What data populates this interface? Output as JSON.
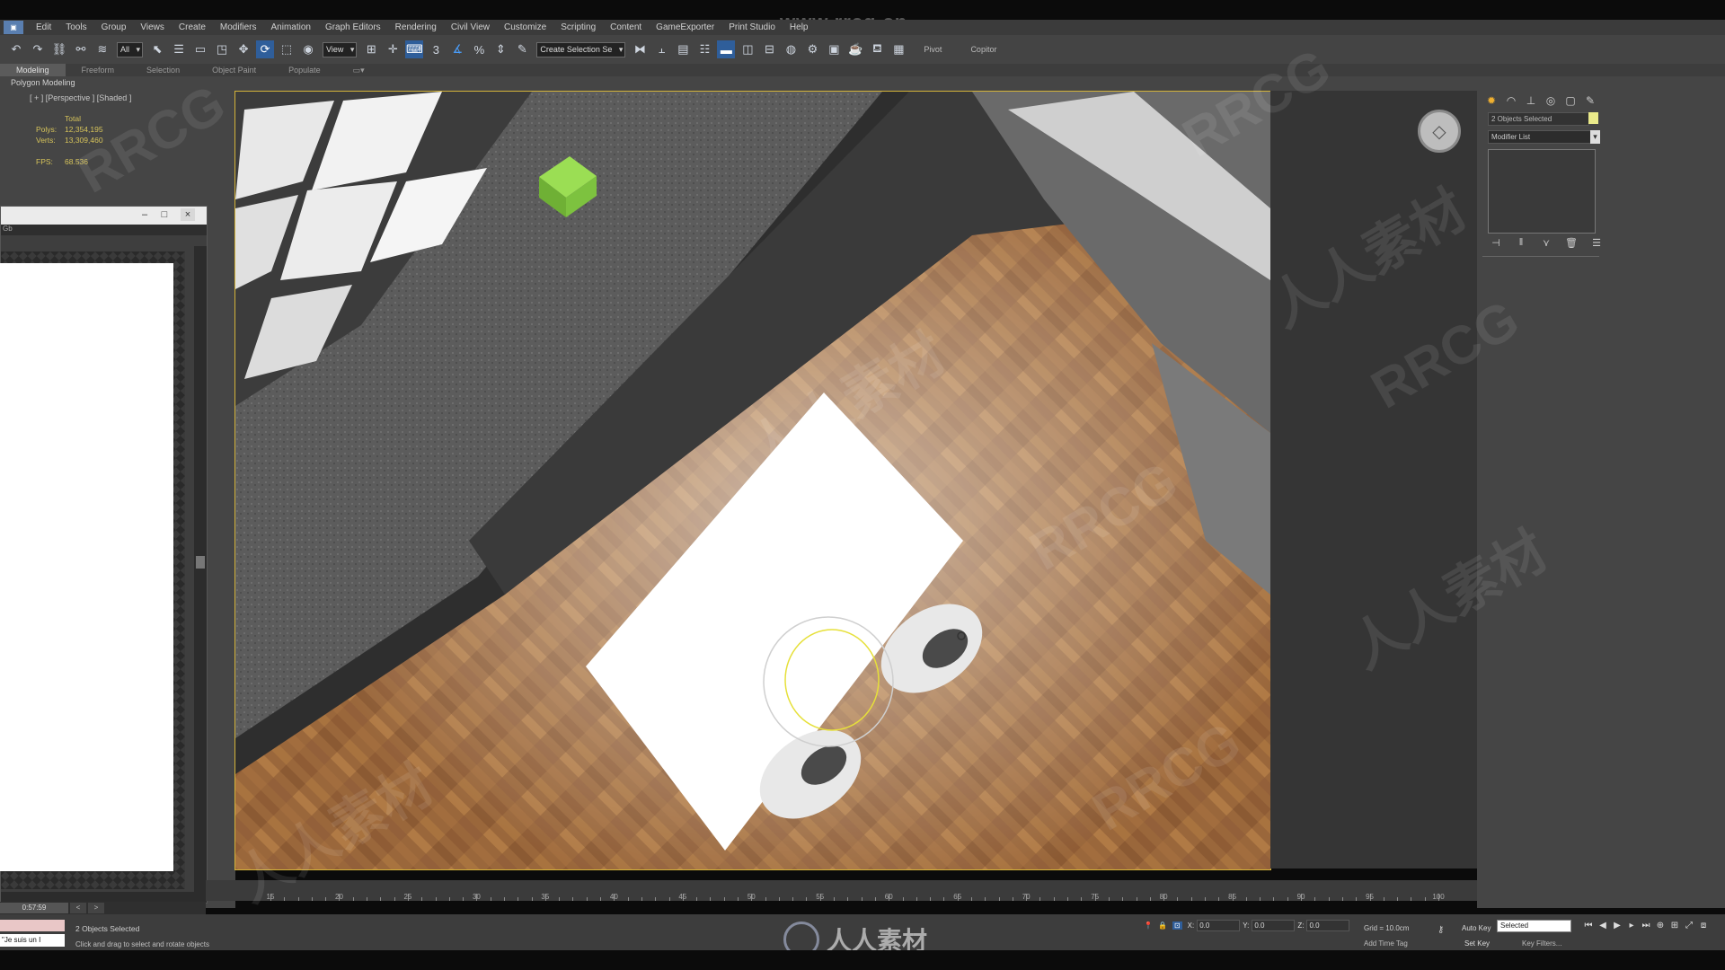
{
  "watermark_url": "www.rrcg.cn",
  "watermark_text_1": "RRCG",
  "watermark_text_2": "人人素材",
  "menu": [
    "Edit",
    "Tools",
    "Group",
    "Views",
    "Create",
    "Modifiers",
    "Animation",
    "Graph Editors",
    "Rendering",
    "Civil View",
    "Customize",
    "Scripting",
    "Content",
    "GameExporter",
    "Print Studio",
    "Help"
  ],
  "app_label": "",
  "toolbar": {
    "filter_value": "All",
    "refcoord_value": "View",
    "selset_value": "Create Selection Se",
    "pivot_label": "Pivot",
    "copitor_label": "Copitor"
  },
  "ribbon_tabs": [
    "Modeling",
    "Freeform",
    "Selection",
    "Object Paint",
    "Populate"
  ],
  "polygon_modeling_label": "Polygon Modeling",
  "viewport": {
    "label": "[ + ] [Perspective ] [Shaded ]",
    "stats_total": "Total",
    "polys_label": "Polys:",
    "polys_value": "12,354,195",
    "verts_label": "Verts:",
    "verts_value": "13,309,460",
    "fps_label": "FPS:",
    "fps_value": "68.536"
  },
  "float_window": {
    "sub_label": "Gb"
  },
  "command_panel": {
    "objects_selected": "2 Objects Selected",
    "modifier_list": "Modifier List"
  },
  "timeline": {
    "ticks": [
      "15",
      "20",
      "25",
      "30",
      "35",
      "40",
      "45",
      "50",
      "55",
      "60",
      "65",
      "70",
      "75",
      "80",
      "85",
      "90",
      "95",
      "100"
    ],
    "time_value": "0:57:59"
  },
  "status": {
    "maxscript_value": "\"Je suis un I",
    "selection": "2 Objects Selected",
    "prompt": "Click and drag to select and rotate objects",
    "x_label": "X:",
    "x_value": "0.0",
    "y_label": "Y:",
    "y_value": "0.0",
    "z_label": "Z:",
    "z_value": "0.0",
    "grid": "Grid = 10.0cm",
    "add_time_tag": "Add Time Tag",
    "auto_key": "Auto Key",
    "key_mode": "Selected",
    "set_key": "Set Key",
    "key_filters": "Key Filters..."
  },
  "bottom_logo_text": "人人素材",
  "colors": {
    "viewport_border": "#d4b43a",
    "cube_green": "#8bd14a",
    "floor": "#9c6a3d",
    "counter": "#5a5a5a"
  }
}
